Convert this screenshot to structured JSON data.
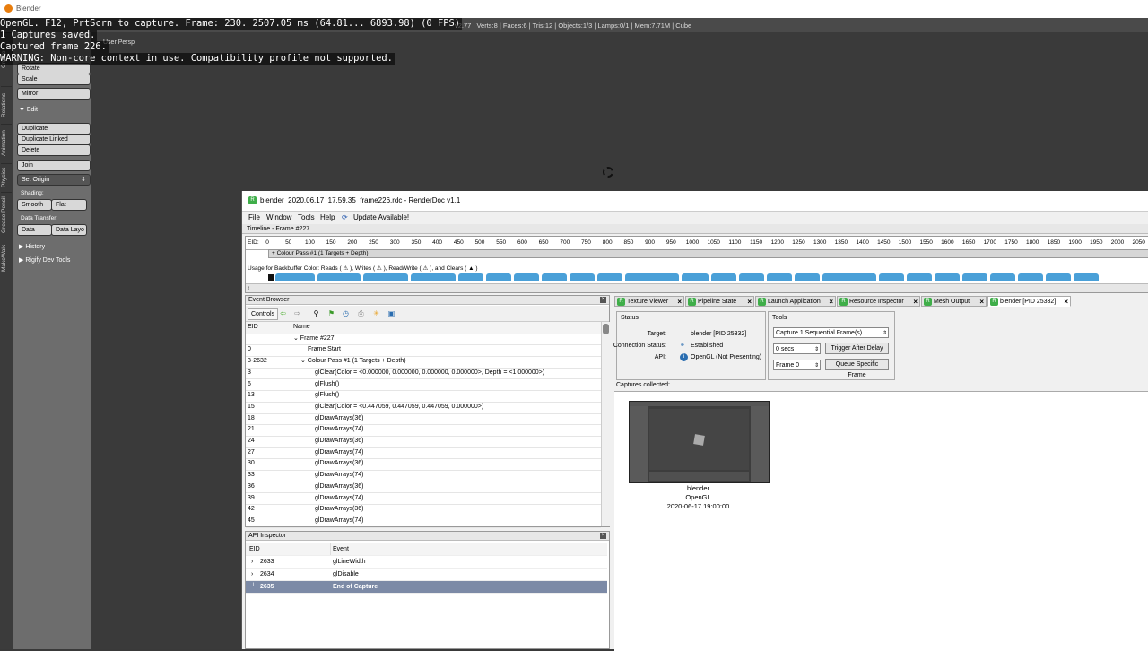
{
  "blender": {
    "window_title": "Blender",
    "overlay_lines": [
      "OpenGL. F12, PrtScrn to capture. Frame: 230. 2507.05 ms (64.81... 6893.98) (0 FPS)",
      "1 Captures saved.",
      "Captured frame 226.",
      "WARNING: Non-core context in use. Compatibility profile not supported."
    ],
    "info_bar": "v2.77 | Verts:8 | Faces:6 | Tris:12 | Objects:1/3 | Lamps:0/1 | Mem:7.71M | Cube",
    "viewport_label": "User Persp",
    "side_tabs": [
      "Create",
      "Relations",
      "Animation",
      "Physics",
      "Grease Pencil",
      "MakeWalk"
    ],
    "tools": {
      "rotate": "Rotate",
      "scale": "Scale",
      "mirror": "Mirror",
      "edit_header": "▼ Edit",
      "duplicate": "Duplicate",
      "duplicate_linked": "Duplicate Linked",
      "delete": "Delete",
      "join": "Join",
      "set_origin": "Set Origin",
      "shading_label": "Shading:",
      "smooth": "Smooth",
      "flat": "Flat",
      "data_transfer_label": "Data Transfer:",
      "data": "Data",
      "data_layout": "Data Layo",
      "history": "▶ History",
      "rigify": "▶ Rigify Dev Tools"
    }
  },
  "renderdoc": {
    "title": "blender_2020.06.17_17.59.35_frame226.rdc - RenderDoc v1.1",
    "menu": {
      "file": "File",
      "window": "Window",
      "tools": "Tools",
      "help": "Help",
      "update": "Update Available!"
    },
    "timeline": {
      "header": "Timeline - Frame #227",
      "eid_label": "EID:",
      "ticks": [
        "0",
        "50",
        "100",
        "150",
        "200",
        "250",
        "300",
        "350",
        "400",
        "450",
        "500",
        "550",
        "600",
        "650",
        "700",
        "750",
        "800",
        "850",
        "900",
        "950",
        "1000",
        "1050",
        "1100",
        "1150",
        "1200",
        "1250",
        "1300",
        "1350",
        "1400",
        "1450",
        "1500",
        "1550",
        "1600",
        "1650",
        "1700",
        "1750",
        "1800",
        "1850",
        "1900",
        "1950",
        "2000",
        "2050"
      ],
      "pass_label": "+ Colour Pass #1 (1 Targets + Depth)",
      "usage": "Usage for Backbuffer Color: Reads ( ⚠ ), Writes ( ⚠ ), Read/Write ( ⚠ ), and Clears ( ▲ )"
    },
    "event_browser": {
      "title": "Event Browser",
      "controls": "Controls",
      "col_eid": "EID",
      "col_name": "Name",
      "rows": [
        {
          "eid": "",
          "name": "⌄ Frame #227",
          "indent": 0
        },
        {
          "eid": "0",
          "name": "Frame Start",
          "indent": 2
        },
        {
          "eid": "3-2632",
          "name": "⌄ Colour Pass #1 (1 Targets + Depth)",
          "indent": 1
        },
        {
          "eid": "3",
          "name": "glClear(Color = <0.000000, 0.000000, 0.000000, 0.000000>, Depth = <1.000000>)",
          "indent": 3
        },
        {
          "eid": "6",
          "name": "glFlush()",
          "indent": 3
        },
        {
          "eid": "13",
          "name": "glFlush()",
          "indent": 3
        },
        {
          "eid": "15",
          "name": "glClear(Color = <0.447059, 0.447059, 0.447059, 0.000000>)",
          "indent": 3
        },
        {
          "eid": "18",
          "name": "glDrawArrays(36)",
          "indent": 3
        },
        {
          "eid": "21",
          "name": "glDrawArrays(74)",
          "indent": 3
        },
        {
          "eid": "24",
          "name": "glDrawArrays(36)",
          "indent": 3
        },
        {
          "eid": "27",
          "name": "glDrawArrays(74)",
          "indent": 3
        },
        {
          "eid": "30",
          "name": "glDrawArrays(36)",
          "indent": 3
        },
        {
          "eid": "33",
          "name": "glDrawArrays(74)",
          "indent": 3
        },
        {
          "eid": "36",
          "name": "glDrawArrays(36)",
          "indent": 3
        },
        {
          "eid": "39",
          "name": "glDrawArrays(74)",
          "indent": 3
        },
        {
          "eid": "42",
          "name": "glDrawArrays(36)",
          "indent": 3
        },
        {
          "eid": "45",
          "name": "glDrawArrays(74)",
          "indent": 3
        }
      ]
    },
    "api_inspector": {
      "title": "API Inspector",
      "col_eid": "EID",
      "col_event": "Event",
      "rows": [
        {
          "eid": "2633",
          "event": "glLineWidth",
          "expand": "›"
        },
        {
          "eid": "2634",
          "event": "glDisable",
          "expand": "›"
        },
        {
          "eid": "2635",
          "event": "End of Capture",
          "expand": "└"
        }
      ]
    },
    "tabs": [
      {
        "label": "Texture Viewer"
      },
      {
        "label": "Pipeline State"
      },
      {
        "label": "Launch Application"
      },
      {
        "label": "Resource Inspector"
      },
      {
        "label": "Mesh Output"
      },
      {
        "label": "blender [PID 25332]"
      }
    ],
    "status": {
      "title": "Status",
      "target_label": "Target:",
      "target_value": "blender [PID 25332]",
      "conn_label": "Connection Status:",
      "conn_value": "Established",
      "api_label": "API:",
      "api_value": "OpenGL (Not Presenting)"
    },
    "tools_group": {
      "title": "Tools",
      "capture_value": "Capture 1 Sequential Frame(s)",
      "delay_value": "0 secs",
      "trigger_label": "Trigger After Delay",
      "frame_value": "Frame 0",
      "queue_label": "Queue Specific Frame"
    },
    "captures": {
      "label": "Captures collected:",
      "items": [
        {
          "name": "blender",
          "api": "OpenGL",
          "time": "2020-06-17 19:00:00"
        }
      ]
    }
  }
}
